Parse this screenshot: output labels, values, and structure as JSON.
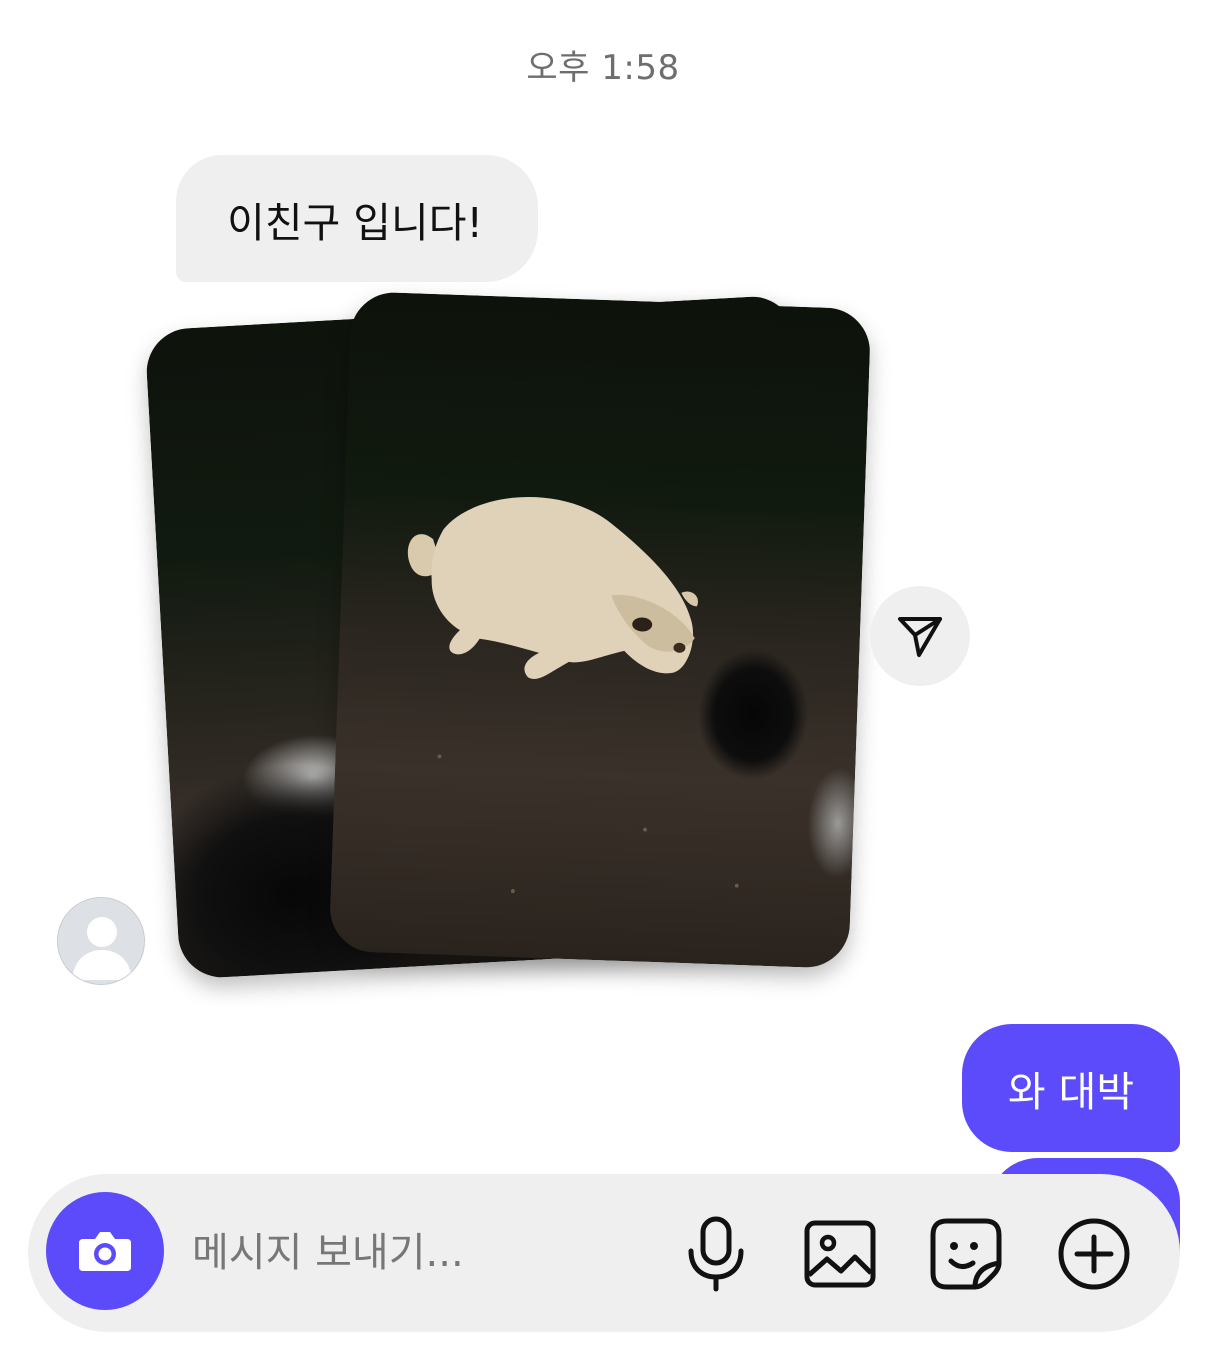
{
  "chat": {
    "timestamp": "오후 1:58",
    "messages": [
      {
        "from": "other",
        "text": "이친구 입니다!"
      },
      {
        "from": "me",
        "text": "와 대박"
      }
    ]
  },
  "photos": {
    "count": 2,
    "icons": [
      "share-icon"
    ]
  },
  "composer": {
    "placeholder": "메시지 보내기...",
    "value": "",
    "icons": [
      "camera-icon",
      "microphone-icon",
      "image-icon",
      "sticker-icon",
      "add-icon"
    ]
  },
  "colors": {
    "accent": "#5b4bfa",
    "incoming_bubble": "#efefef",
    "composer_bg": "#efefef",
    "timestamp": "#6e6e6e"
  }
}
